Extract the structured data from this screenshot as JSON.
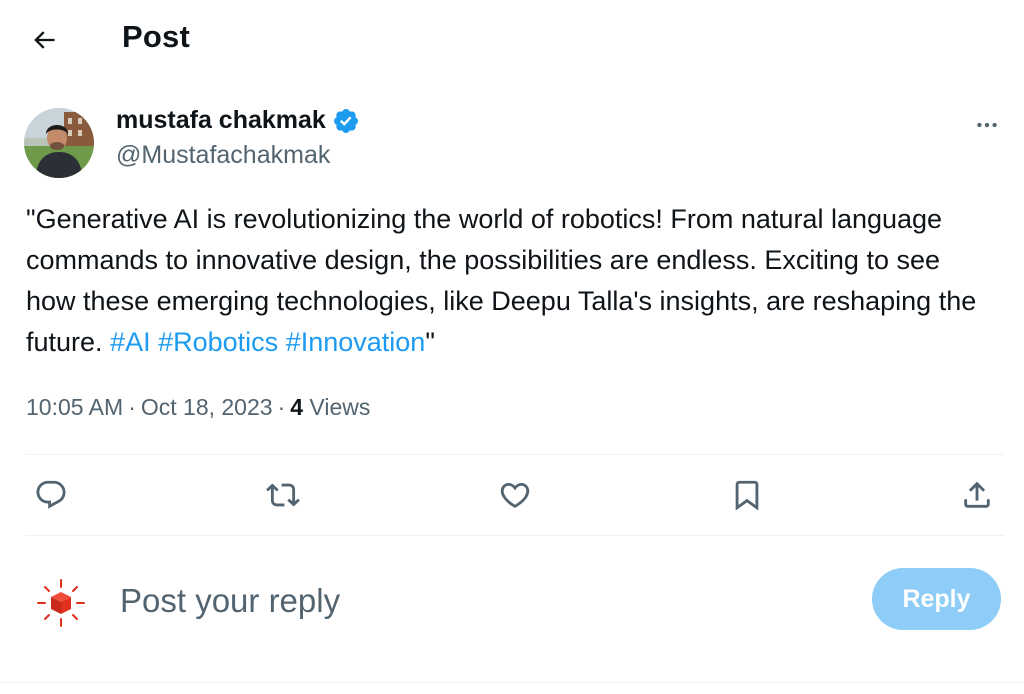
{
  "header": {
    "title": "Post",
    "back_icon": "arrow-left-icon"
  },
  "author": {
    "name": "mustafa chakmak",
    "handle": "@Mustafachakmak",
    "verified_color": "#1d9bf0"
  },
  "post": {
    "text": "\"Generative AI is revolutionizing the world of robotics! From natural language commands to innovative design, the possibilities are endless. Exciting to see how these emerging technologies, like Deepu Talla's insights, are reshaping the future. ",
    "hashtags": [
      "#AI",
      "#Robotics",
      "#Innovation"
    ],
    "text_end": "\""
  },
  "meta": {
    "time": "10:05 AM",
    "date": "Oct 18, 2023",
    "separator": "·",
    "views_count": "4",
    "views_label": "Views"
  },
  "actions": [
    {
      "name": "reply",
      "icon": "reply-icon"
    },
    {
      "name": "repost",
      "icon": "repost-icon"
    },
    {
      "name": "like",
      "icon": "heart-icon"
    },
    {
      "name": "bookmark",
      "icon": "bookmark-icon"
    },
    {
      "name": "share",
      "icon": "share-icon"
    }
  ],
  "reply": {
    "placeholder": "Post your reply",
    "button_label": "Reply"
  },
  "colors": {
    "accent": "#1d9bf0",
    "secondary_text": "#536471",
    "reply_button_disabled": "#8ecdf8"
  }
}
